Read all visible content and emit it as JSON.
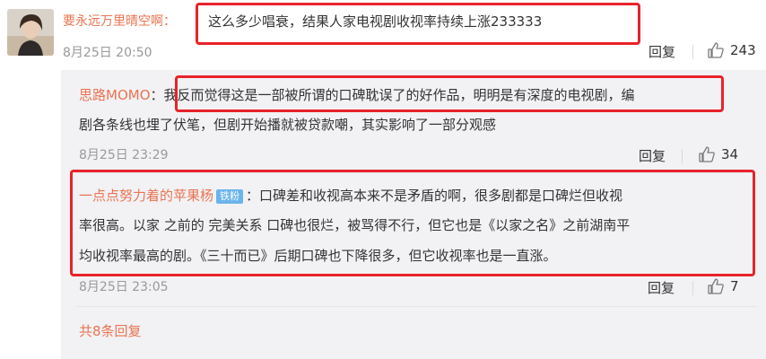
{
  "comment": {
    "author": "要永远万里晴空啊",
    "separator": "：",
    "text": "这么多少唱衰，结果人家电视剧收视率持续上涨233333",
    "time": "8月25日 20:50",
    "reply_label": "回复",
    "like_count": "243"
  },
  "replies": [
    {
      "author": "思路MOMO",
      "separator": "：",
      "text_line1": "我反而觉得这是一部被所谓的口碑耽误了的好作品，明明是有深度的电视剧，编",
      "text_line2": "剧各条线也埋了伏笔，但剧开始播就被贷款嘲，其实影响了一部分观感",
      "time": "8月25日 23:29",
      "reply_label": "回复",
      "like_count": "34"
    },
    {
      "author": "一点点努力着的苹果杨",
      "badge": "铁粉",
      "separator": "：",
      "text_line1": "口碑差和收视高本来不是矛盾的啊，很多剧都是口碑烂但收视",
      "text_line2": "率很高。以家 之前的 完美关系 口碑也很烂，被骂得不行，但它也是《以家之名》之前湖南平",
      "text_line3": "均收视率最高的剧。《三十而已》后期口碑也下降很多，但它收视率也是一直涨。",
      "time": "8月25日 23:05",
      "reply_label": "回复",
      "like_count": "7"
    }
  ],
  "footer": {
    "more_replies": "共8条回复"
  },
  "icons": {
    "like": "thumbs-up-icon"
  },
  "colors": {
    "accent": "#eb7350",
    "highlight": "#e8232a",
    "reply_bg": "#f2f2f5",
    "badge": "#6bb4ea"
  }
}
